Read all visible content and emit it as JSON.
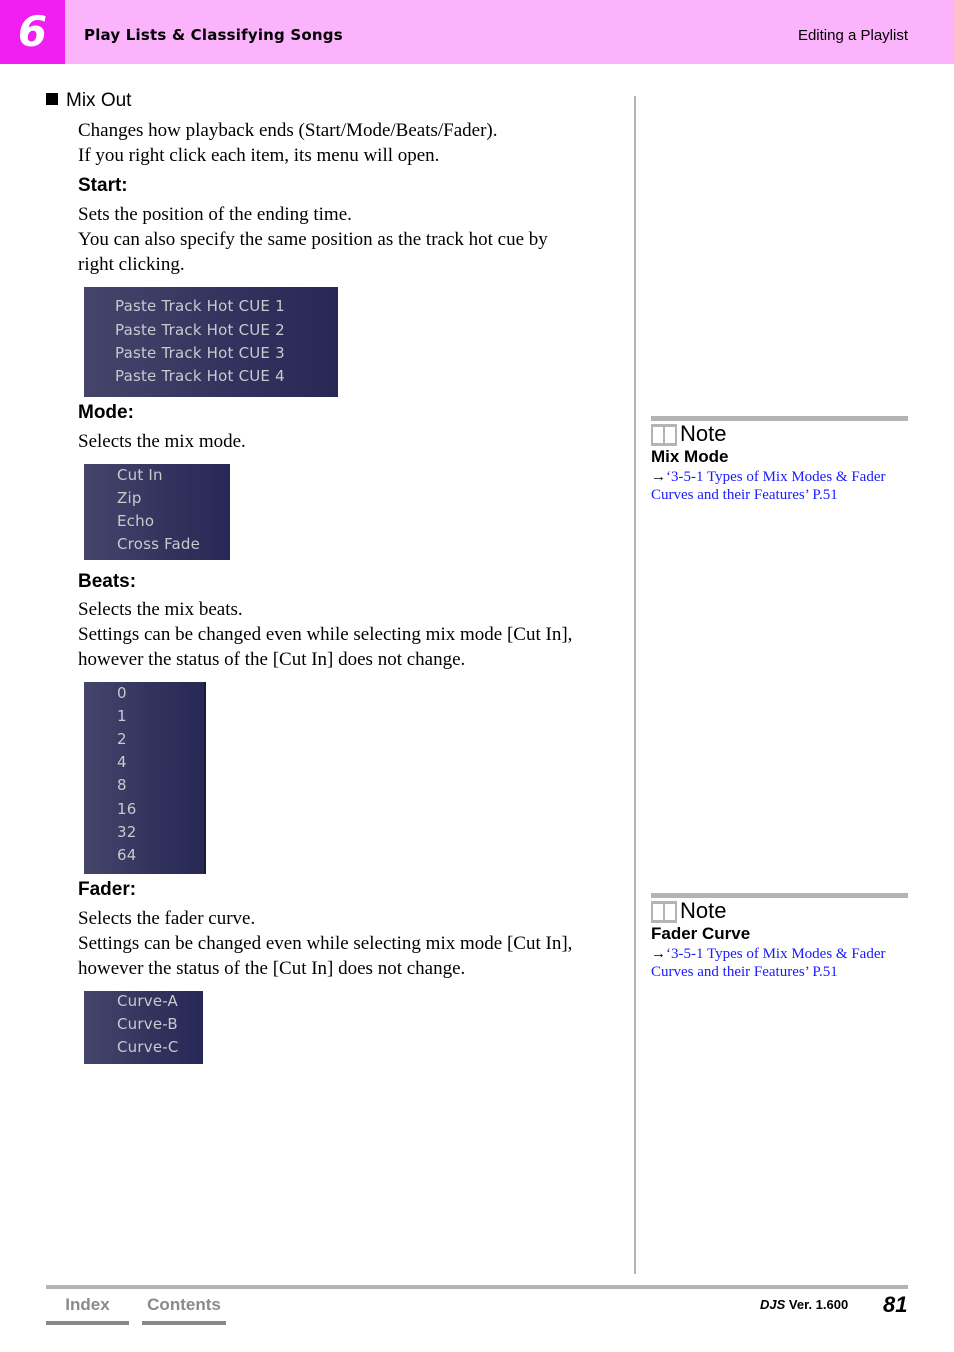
{
  "header": {
    "chapter_number": "6",
    "chapter_title": "Play Lists & Classifying Songs",
    "section_title": "Editing a Playlist"
  },
  "main": {
    "heading": "Mix Out",
    "intro": [
      "Changes how playback ends (Start/Mode/Beats/Fader).",
      "If you right click each item, its menu will open."
    ],
    "start": {
      "title": "Start:",
      "text": [
        "Sets the position of the ending time.",
        "You can also specify the same position as the track hot cue by",
        "right clicking."
      ],
      "menu_items": [
        "Paste Track Hot CUE 1",
        "Paste Track Hot CUE 2",
        "Paste Track Hot CUE 3",
        "Paste Track Hot CUE 4"
      ]
    },
    "mode": {
      "title": "Mode:",
      "text": [
        "Selects the mix mode."
      ],
      "menu_items": [
        "Cut In",
        "Zip",
        "Echo",
        "Cross Fade"
      ]
    },
    "beats": {
      "title": "Beats:",
      "text": [
        "Selects the mix beats.",
        "Settings can be changed even while selecting mix mode [Cut In],",
        "however the status of the [Cut In] does not change."
      ],
      "menu_items": [
        "0",
        "1",
        "2",
        "4",
        "8",
        "16",
        "32",
        "64"
      ]
    },
    "fader": {
      "title": "Fader:",
      "text": [
        "Selects the fader curve.",
        "Settings can be changed even while selecting mix mode [Cut In],",
        "however the status of the [Cut In] does not change."
      ],
      "menu_items": [
        "Curve-A",
        "Curve-B",
        "Curve-C"
      ]
    }
  },
  "notes": [
    {
      "label": "Note",
      "title": "Mix Mode",
      "arrow": "→",
      "link_line1": "‘3-5-1 Types of Mix Modes & Fader",
      "link_line2": "Curves and their Features’ P.51"
    },
    {
      "label": "Note",
      "title": "Fader Curve",
      "arrow": "→",
      "link_line1": "‘3-5-1 Types of Mix Modes & Fader",
      "link_line2": "Curves and their Features’ P.51"
    }
  ],
  "footer": {
    "index_label": "Index",
    "contents_label": "Contents",
    "product": "DJS",
    "version": "Ver. 1.600",
    "page_number": "81"
  },
  "colors": {
    "header_bg": "#fbb3fb",
    "chapter_box": "#f01ef0",
    "link": "#1a1aff",
    "menu_bg": "#33335e",
    "rule_gray": "#b4b4b4"
  }
}
